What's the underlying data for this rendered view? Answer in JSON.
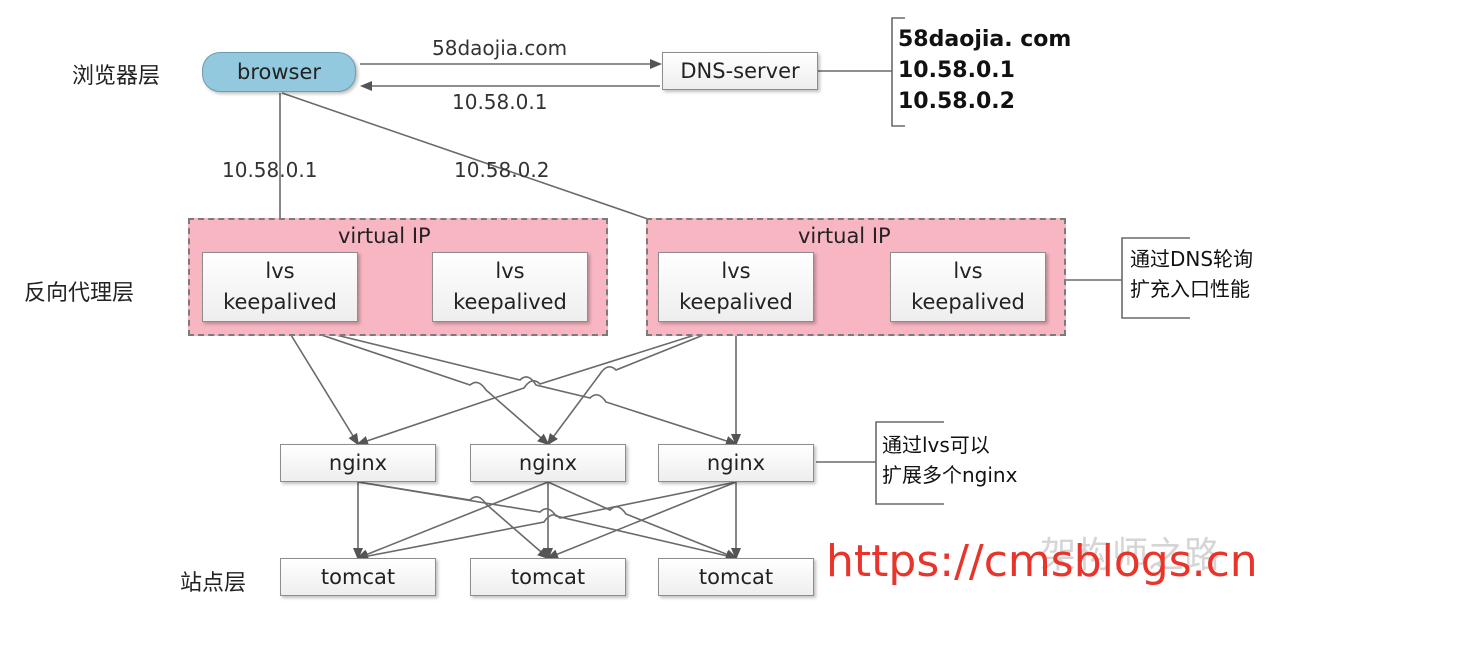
{
  "layers": {
    "browser": "浏览器层",
    "proxy": "反向代理层",
    "site": "站点层"
  },
  "browser_node": {
    "label": "browser"
  },
  "dns": {
    "server_label": "DNS-server",
    "query_label": "58daojia.com",
    "response_label": "10.58.0.1",
    "records": [
      "58daojia. com",
      "10.58.0.1",
      "10.58.0.2"
    ]
  },
  "routes": {
    "left": "10.58.0.1",
    "right": "10.58.0.2"
  },
  "vip_groups": [
    {
      "label": "virtual  IP",
      "nodes": [
        {
          "line1": "lvs",
          "line2": "keepalived"
        },
        {
          "line1": "lvs",
          "line2": "keepalived"
        }
      ]
    },
    {
      "label": "virtual  IP",
      "nodes": [
        {
          "line1": "lvs",
          "line2": "keepalived"
        },
        {
          "line1": "lvs",
          "line2": "keepalived"
        }
      ]
    }
  ],
  "nginx_nodes": [
    "nginx",
    "nginx",
    "nginx"
  ],
  "tomcat_nodes": [
    "tomcat",
    "tomcat",
    "tomcat"
  ],
  "notes": {
    "dns_line1": "通过DNS轮询",
    "dns_line2": "扩充入口性能",
    "lvs_line1": "通过lvs可以",
    "lvs_line2": "扩展多个nginx"
  },
  "watermark": {
    "url": "https://cmsblogs.cn",
    "background": "架构师之路"
  }
}
